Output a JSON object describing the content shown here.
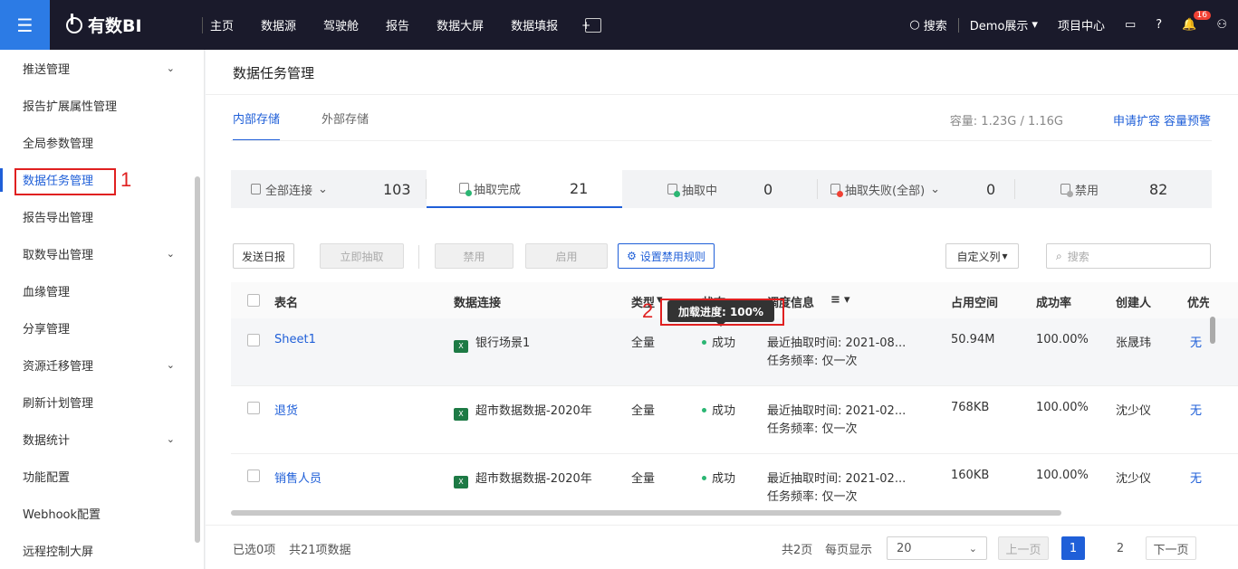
{
  "topbar": {
    "logo": "有数BI",
    "nav": [
      "主页",
      "数据源",
      "驾驶舱",
      "报告",
      "数据大屏",
      "数据填报"
    ],
    "plus_icon": "+",
    "search": "搜索",
    "project": "Demo展示",
    "project_center": "项目中心",
    "notification_count": "16"
  },
  "sidebar": {
    "items": [
      {
        "label": "推送管理",
        "chevron": "⌄"
      },
      {
        "label": "报告扩展属性管理",
        "chevron": ""
      },
      {
        "label": "全局参数管理",
        "chevron": ""
      },
      {
        "label": "数据任务管理",
        "chevron": ""
      },
      {
        "label": "报告导出管理",
        "chevron": ""
      },
      {
        "label": "取数导出管理",
        "chevron": "⌄"
      },
      {
        "label": "血缘管理",
        "chevron": ""
      },
      {
        "label": "分享管理",
        "chevron": ""
      },
      {
        "label": "资源迁移管理",
        "chevron": "⌄"
      },
      {
        "label": "刷新计划管理",
        "chevron": ""
      },
      {
        "label": "数据统计",
        "chevron": "⌄"
      },
      {
        "label": "功能配置",
        "chevron": ""
      },
      {
        "label": "Webhook配置",
        "chevron": ""
      },
      {
        "label": "远程控制大屏",
        "chevron": ""
      }
    ]
  },
  "annotations": {
    "a1": "1",
    "a2": "2"
  },
  "main": {
    "title": "数据任务管理",
    "tabs": [
      "内部存储",
      "外部存储"
    ],
    "capacity": "容量: 1.23G / 1.16G",
    "apply_expand": "申请扩容",
    "capacity_alert": "容量预警"
  },
  "stats": [
    {
      "label": "全部连接",
      "value": "103"
    },
    {
      "label": "抽取完成",
      "value": "21"
    },
    {
      "label": "抽取中",
      "value": "0"
    },
    {
      "label": "抽取失败(全部)",
      "value": "0"
    },
    {
      "label": "禁用",
      "value": "82"
    }
  ],
  "toolbar": {
    "send_report": "发送日报",
    "extract_now": "立即抽取",
    "disable": "禁用",
    "enable": "启用",
    "set_disable_rule": "设置禁用规则",
    "custom_columns": "自定义列",
    "search_placeholder": "搜索"
  },
  "table": {
    "headers": {
      "name": "表名",
      "connection": "数据连接",
      "type": "类型",
      "status": "状态",
      "schedule": "调度信息",
      "space": "占用空间",
      "success": "成功率",
      "creator": "创建人",
      "priority": "优先级"
    },
    "rows": [
      {
        "name": "Sheet1",
        "connection": "银行场景1",
        "type": "全量",
        "status": "成功",
        "line1": "最近抽取时间: 2021-08...",
        "line2": "任务频率: 仅一次",
        "space": "50.94M",
        "success": "100.00%",
        "creator": "张晟玮",
        "priority": "无"
      },
      {
        "name": "退货",
        "connection": "超市数据数据-2020年",
        "type": "全量",
        "status": "成功",
        "line1": "最近抽取时间: 2021-02...",
        "line2": "任务频率: 仅一次",
        "space": "768KB",
        "success": "100.00%",
        "creator": "沈少仪",
        "priority": "无"
      },
      {
        "name": "销售人员",
        "connection": "超市数据数据-2020年",
        "type": "全量",
        "status": "成功",
        "line1": "最近抽取时间: 2021-02...",
        "line2": "任务频率: 仅一次",
        "space": "160KB",
        "success": "100.00%",
        "creator": "沈少仪",
        "priority": "无"
      }
    ],
    "tooltip": "加载进度: 100%"
  },
  "footer": {
    "selected": "已选0项",
    "total": "共21项数据",
    "pages": "共2页",
    "per_page_label": "每页显示",
    "per_page": "20",
    "prev": "上一页",
    "page1": "1",
    "page2": "2",
    "next": "下一页"
  }
}
